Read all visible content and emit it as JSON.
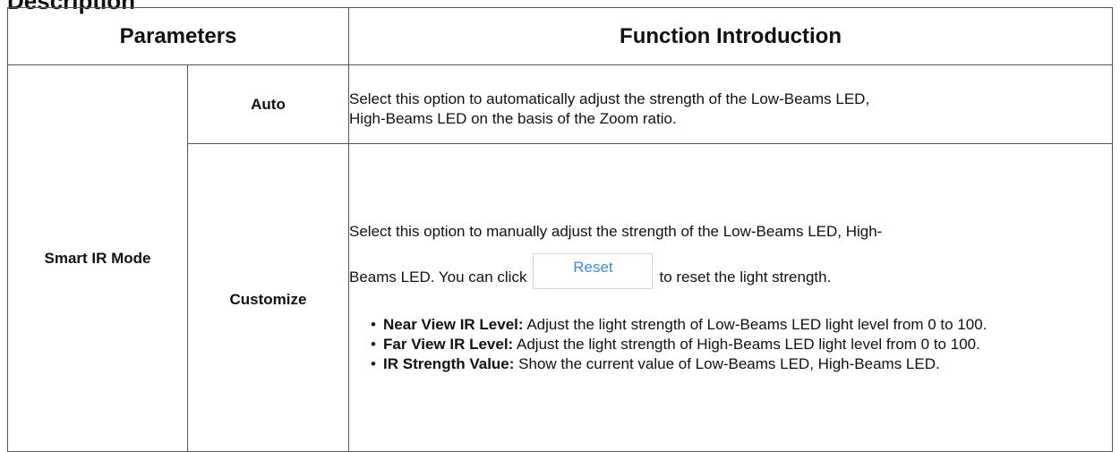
{
  "doc": {
    "cut_title": "Description"
  },
  "table": {
    "headers": [
      "Parameters",
      "Function Introduction"
    ],
    "mode": "Smart IR Mode",
    "rows": [
      {
        "option": "Auto",
        "desc_line1": "Select this option to automatically adjust the strength of the Low-Beams LED,",
        "desc_line2": "High-Beams LED on the basis of the Zoom ratio."
      },
      {
        "option": "Customize",
        "desc_line1": "Select this option to manually adjust the strength of the Low-Beams LED, High-",
        "desc_line2_before": "Beams LED. You can click",
        "reset_label": "Reset",
        "desc_line2_after": "to reset the light strength.",
        "bullets": [
          {
            "term": "Near View IR Level:",
            "text": " Adjust the light strength of Low-Beams LED light level from 0 to 100."
          },
          {
            "term": "Far View IR Level:",
            "text": " Adjust the light strength of High-Beams LED light level from 0 to 100."
          },
          {
            "term": "IR Strength Value:",
            "text": " Show the current value of Low-Beams LED, High-Beams LED."
          }
        ]
      }
    ]
  }
}
